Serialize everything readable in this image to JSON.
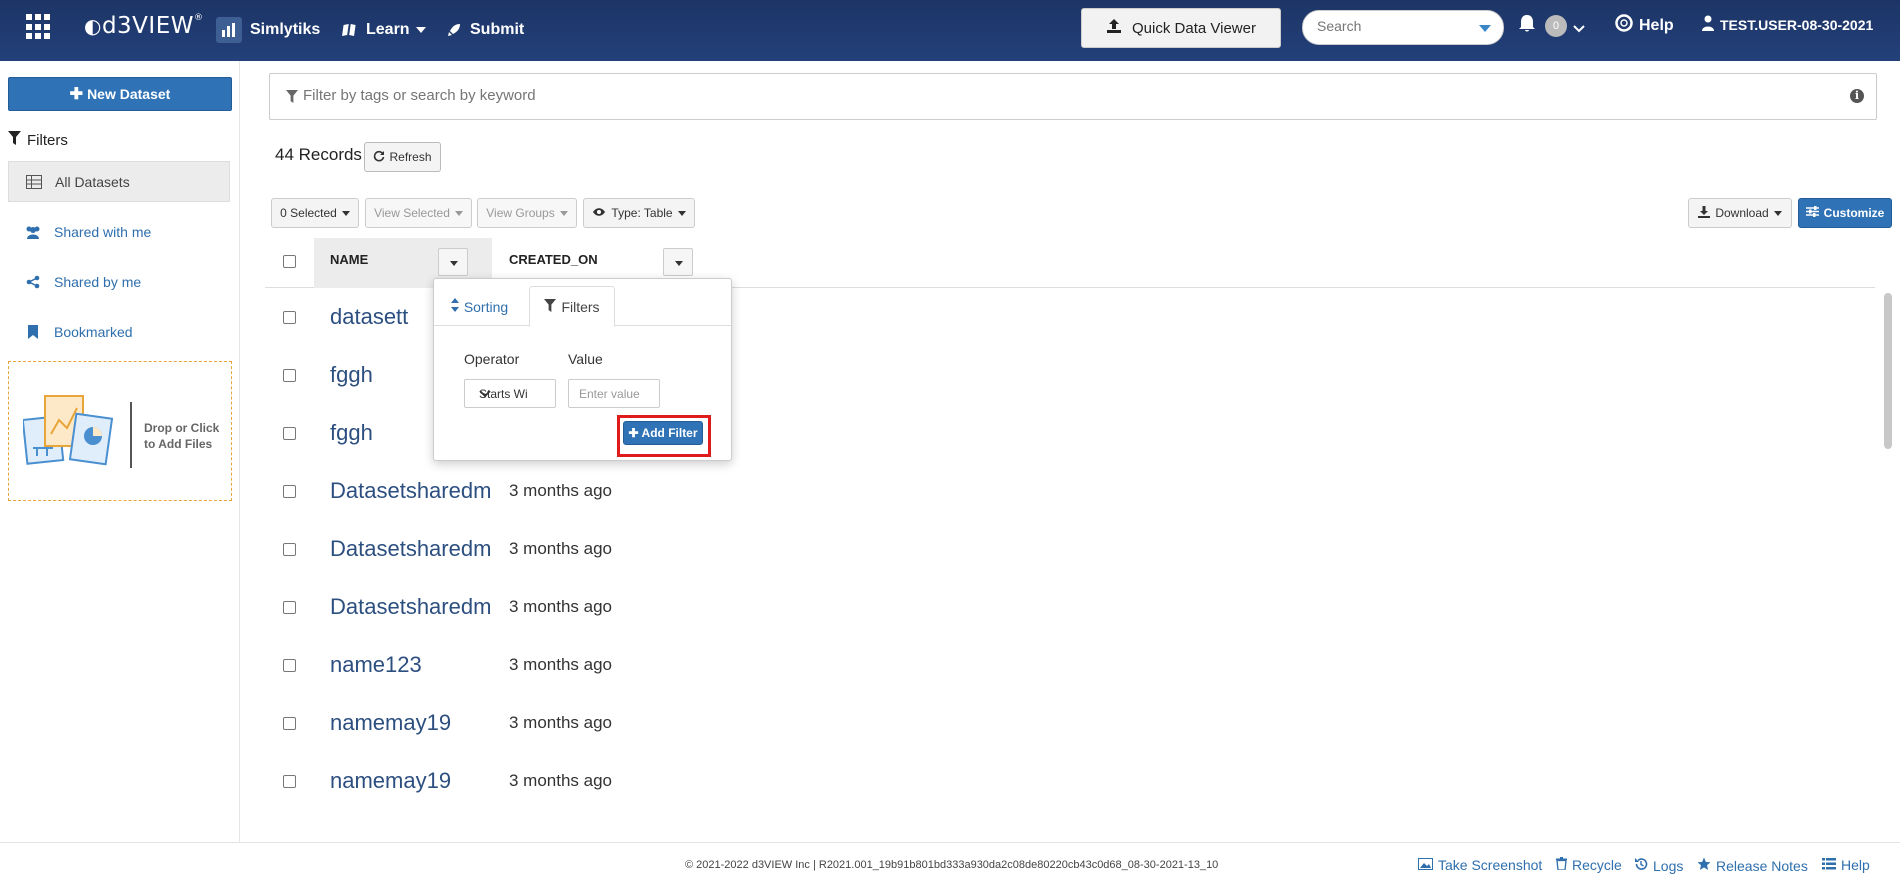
{
  "header": {
    "brand": "d3VIEW",
    "brand_mark": "®",
    "nav": {
      "simlytiks": "Simlytiks",
      "learn": "Learn",
      "submit": "Submit"
    },
    "quick_data_viewer": "Quick Data Viewer",
    "search_placeholder": "Search",
    "notification_count": "0",
    "help": "Help",
    "user": "TEST.USER-08-30-2021"
  },
  "sidebar": {
    "new_dataset": "New Dataset",
    "filters_heading": "Filters",
    "items": [
      {
        "label": "All Datasets",
        "icon": "table-icon",
        "active": true
      },
      {
        "label": "Shared with me",
        "icon": "users-icon"
      },
      {
        "label": "Shared by me",
        "icon": "share-icon"
      },
      {
        "label": "Bookmarked",
        "icon": "bookmark-icon"
      }
    ],
    "dropzone_text": "Drop or Click to Add Files"
  },
  "main": {
    "search_placeholder": "Filter by tags or search by keyword",
    "records": "44 Records",
    "refresh": "Refresh",
    "toolbar": {
      "selected": "0 Selected",
      "view_selected": "View Selected",
      "view_groups": "View Groups",
      "type": "Type: Table",
      "download": "Download",
      "customize": "Customize"
    },
    "columns": {
      "name": "NAME",
      "created_on": "CREATED_ON"
    },
    "rows": [
      {
        "name": "datasett",
        "created_on": ""
      },
      {
        "name": "fggh",
        "created_on": ""
      },
      {
        "name": "fggh",
        "created_on": ""
      },
      {
        "name": "Datasetsharedm",
        "created_on": "3 months ago"
      },
      {
        "name": "Datasetsharedm",
        "created_on": "3 months ago"
      },
      {
        "name": "Datasetsharedm",
        "created_on": "3 months ago"
      },
      {
        "name": "name123",
        "created_on": "3 months ago"
      },
      {
        "name": "namemay19",
        "created_on": "3 months ago"
      },
      {
        "name": "namemay19",
        "created_on": "3 months ago"
      }
    ]
  },
  "popover": {
    "tab_sorting": "Sorting",
    "tab_filters": "Filters",
    "operator_label": "Operator",
    "value_label": "Value",
    "operator_value": "Starts With",
    "value_placeholder": "Enter value",
    "add_filter": "Add Filter"
  },
  "footer": {
    "copyright": "© 2021-2022 d3VIEW Inc | R2021.001_19b91b801bd333a930da2c08de80220cb43c0d68_08-30-2021-13_10",
    "links": {
      "take_screenshot": "Take Screenshot",
      "recycle": "Recycle",
      "logs": "Logs",
      "release_notes": "Release Notes",
      "help": "Help"
    }
  },
  "colors": {
    "navbar": "#1f3a6e",
    "primary": "#2f73b6",
    "link": "#2f6fad",
    "highlight": "#e01b1b",
    "dropzone_border": "#e8a53a"
  }
}
